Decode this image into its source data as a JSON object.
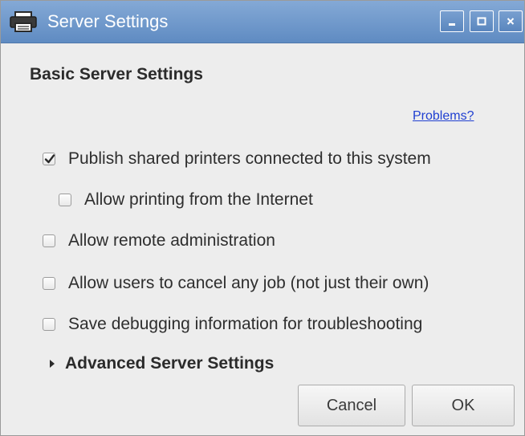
{
  "window": {
    "title": "Server Settings"
  },
  "section": {
    "title": "Basic Server Settings",
    "problems_link": "Problems?"
  },
  "options": [
    {
      "label": "Publish shared printers connected to this system",
      "checked": true
    },
    {
      "label": "Allow printing from the Internet",
      "checked": false
    },
    {
      "label": "Allow remote administration",
      "checked": false
    },
    {
      "label": "Allow users to cancel any job (not just their own)",
      "checked": false
    },
    {
      "label": "Save debugging information for troubleshooting",
      "checked": false
    }
  ],
  "advanced": {
    "label": "Advanced Server Settings",
    "expanded": false
  },
  "buttons": {
    "cancel": "Cancel",
    "ok": "OK"
  },
  "icons": {
    "app": "printer-icon",
    "minimize": "minimize-icon",
    "maximize": "maximize-icon",
    "close": "close-icon"
  },
  "colors": {
    "titlebar": "#6c95c8",
    "link": "#1f3fd1",
    "background": "#ededed"
  }
}
